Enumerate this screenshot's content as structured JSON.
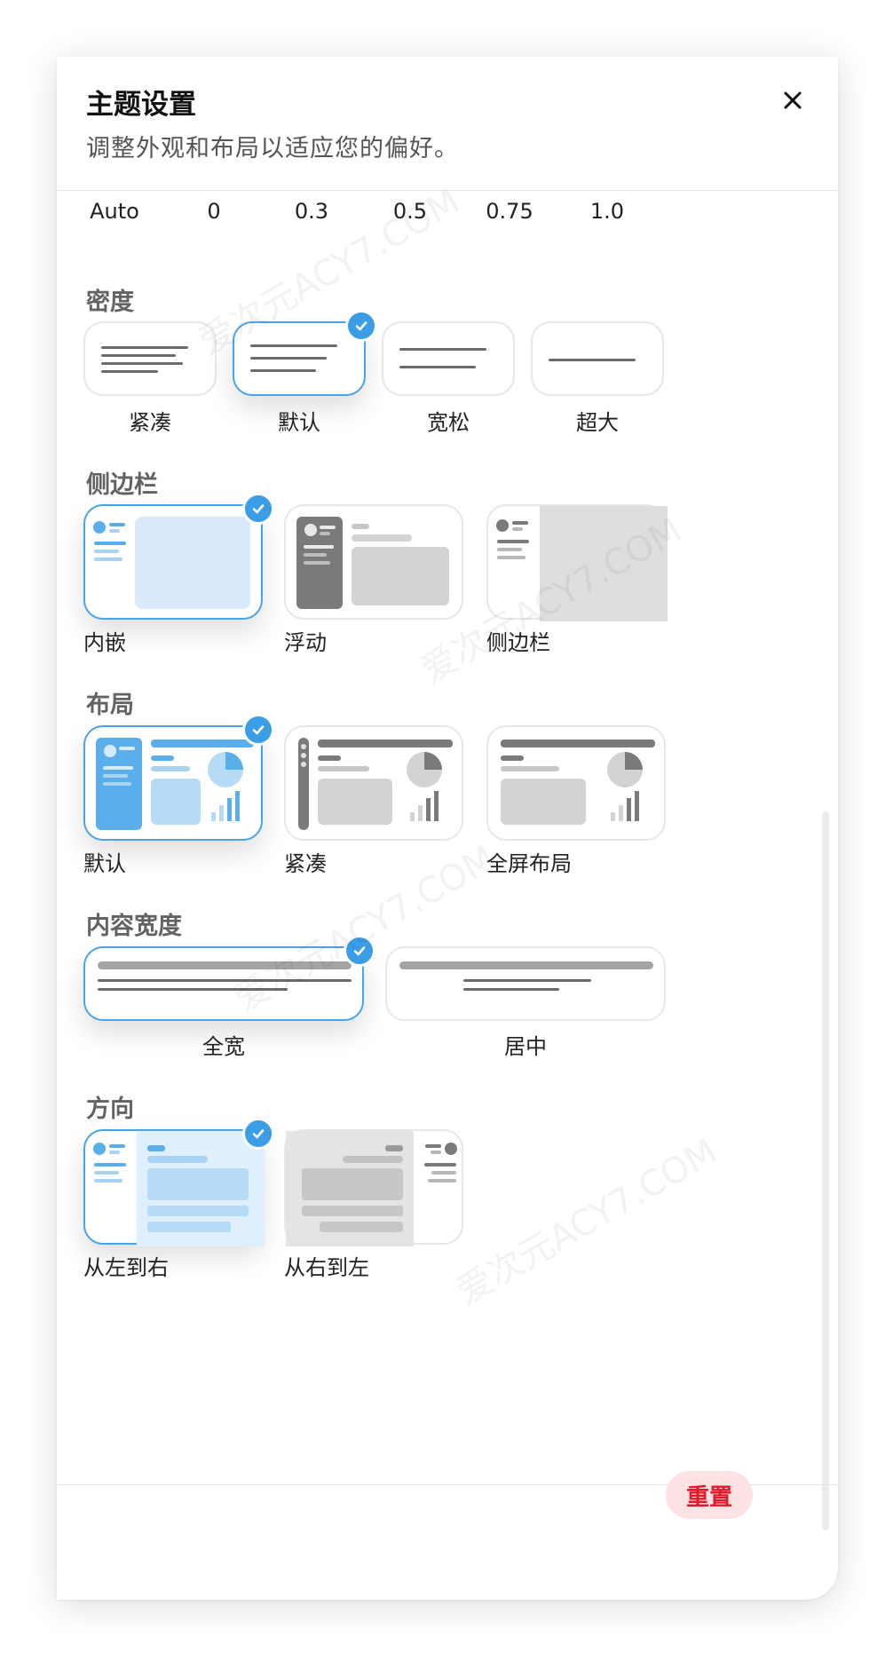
{
  "panel": {
    "title": "主题设置",
    "subtitle": "调整外观和布局以适应您的偏好。"
  },
  "opacity": {
    "options": [
      "Auto",
      "0",
      "0.3",
      "0.5",
      "0.75",
      "1.0"
    ]
  },
  "density": {
    "label": "密度",
    "options": [
      "紧凑",
      "默认",
      "宽松",
      "超大"
    ],
    "selected": "默认"
  },
  "sidebar": {
    "label": "侧边栏",
    "options": [
      "内嵌",
      "浮动",
      "侧边栏"
    ],
    "selected": "内嵌"
  },
  "layout": {
    "label": "布局",
    "options": [
      "默认",
      "紧凑",
      "全屏布局"
    ],
    "selected": "默认"
  },
  "content_width": {
    "label": "内容宽度",
    "options": [
      "全宽",
      "居中"
    ],
    "selected": "全宽"
  },
  "direction": {
    "label": "方向",
    "options": [
      "从左到右",
      "从右到左"
    ],
    "selected": "从左到右"
  },
  "footer": {
    "reset_label": "重置"
  },
  "watermark_text": "爱次元ACY7.COM",
  "colors": {
    "accent": "#3b9de6",
    "selected_border": "#4ba3e6",
    "reset_text": "#e2192a",
    "reset_bg": "#fde3e3"
  },
  "icons": {
    "close": "close-icon",
    "check": "check-icon"
  }
}
